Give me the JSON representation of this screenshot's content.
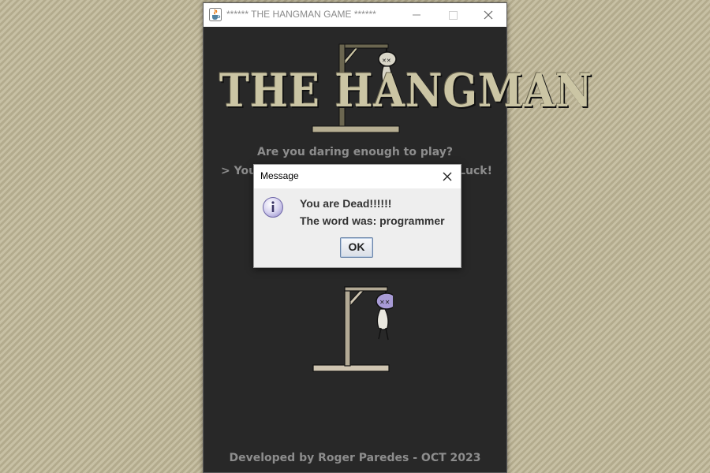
{
  "window": {
    "title": "****** THE HANGMAN GAME ******",
    "icon": "java-cup-icon"
  },
  "logo": {
    "title": "THE HANGMAN"
  },
  "main": {
    "tagline": "Are you daring enough to play?",
    "subline_left": "> You",
    "subline_right": "Luck!",
    "footer": "Developed by Roger Paredes - OCT 2023"
  },
  "dialog": {
    "title": "Message",
    "icon": "info-icon",
    "line1": "You are Dead!!!!!!",
    "line2": "The word was: programmer",
    "ok_label": "OK"
  },
  "colors": {
    "window_bg": "#282828",
    "text_gray": "#8d8d8d",
    "logo_beige": "#cbc5a4",
    "dialog_bg": "#eeeeee",
    "head_purple": "#a89bd6"
  }
}
